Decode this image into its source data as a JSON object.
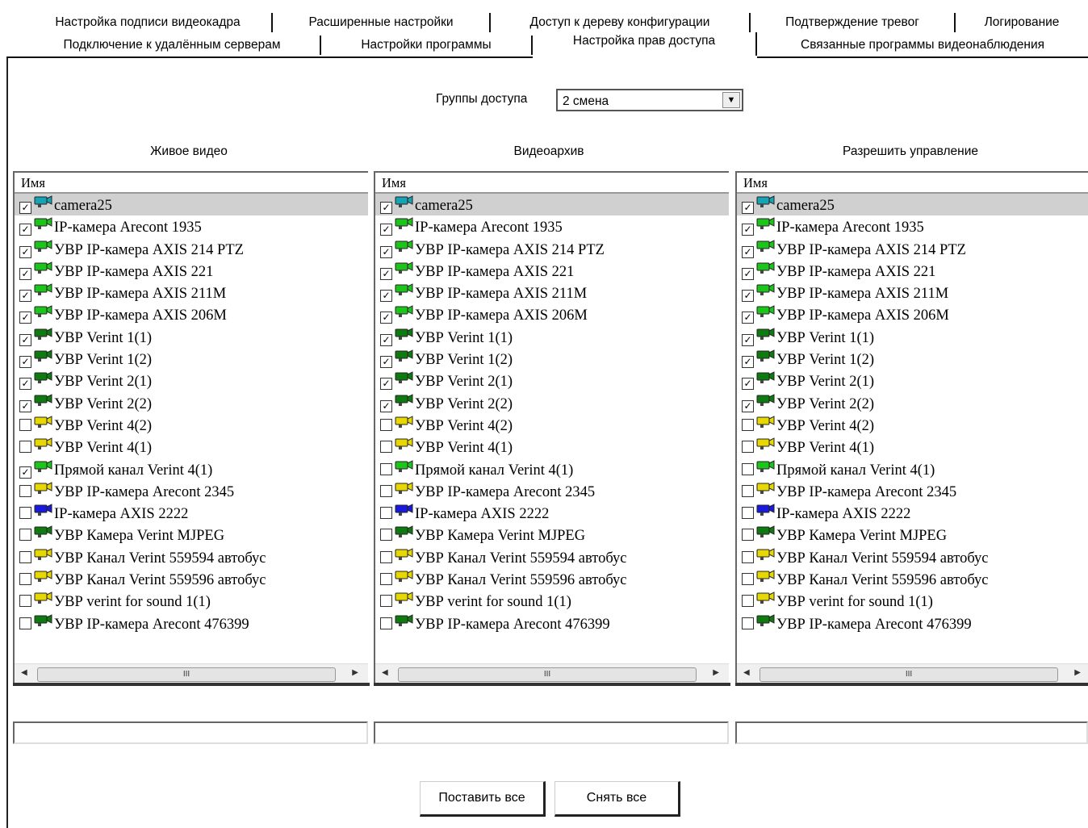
{
  "tabs_row1": [
    "Настройка подписи видеокадра",
    "Расширенные настройки",
    "Доступ к дереву конфигурации",
    "Подтверждение тревог",
    "Логирование"
  ],
  "tabs_row2": [
    "Подключение к удалённым серверам",
    "Настройки программы",
    "Настройка прав доступа",
    "Связанные программы видеонаблюдения"
  ],
  "active_tab": "Настройка прав доступа",
  "access_groups": {
    "label": "Группы доступа",
    "value": "2 смена"
  },
  "column_header": "Имя",
  "columns": [
    {
      "title": "Живое видео",
      "checked": [
        true,
        true,
        true,
        true,
        true,
        true,
        true,
        true,
        true,
        true,
        false,
        false,
        true,
        false,
        false,
        false,
        false,
        false,
        false,
        false
      ]
    },
    {
      "title": "Видеоархив",
      "checked": [
        true,
        true,
        true,
        true,
        true,
        true,
        true,
        true,
        true,
        true,
        false,
        false,
        false,
        false,
        false,
        false,
        false,
        false,
        false,
        false
      ]
    },
    {
      "title": "Разрешить управление",
      "checked": [
        true,
        true,
        true,
        true,
        true,
        true,
        true,
        true,
        true,
        true,
        false,
        false,
        false,
        false,
        false,
        false,
        false,
        false,
        false,
        false
      ]
    }
  ],
  "cameras": [
    {
      "name": "camera25",
      "icon_color": "#17a3b3"
    },
    {
      "name": "IP-камера Arecont 1935",
      "icon_color": "#1cc41c"
    },
    {
      "name": "УВР IP-камера AXIS 214 PTZ",
      "icon_color": "#1cc41c"
    },
    {
      "name": "УВР IP-камера AXIS 221",
      "icon_color": "#1cc41c"
    },
    {
      "name": "УВР IP-камера AXIS 211M",
      "icon_color": "#1cc41c"
    },
    {
      "name": "УВР IP-камера AXIS 206M",
      "icon_color": "#1cc41c"
    },
    {
      "name": "УВР Verint 1(1)",
      "icon_color": "#0f7a0f"
    },
    {
      "name": "УВР Verint 1(2)",
      "icon_color": "#0f7a0f"
    },
    {
      "name": "УВР Verint 2(1)",
      "icon_color": "#0f7a0f"
    },
    {
      "name": "УВР Verint 2(2)",
      "icon_color": "#0f7a0f"
    },
    {
      "name": "УВР Verint 4(2)",
      "icon_color": "#e6d800"
    },
    {
      "name": "УВР Verint 4(1)",
      "icon_color": "#e6d800"
    },
    {
      "name": "Прямой канал Verint 4(1)",
      "icon_color": "#1cc41c"
    },
    {
      "name": "УВР IP-камера Arecont 2345",
      "icon_color": "#e6d800"
    },
    {
      "name": "IP-камера AXIS 2222",
      "icon_color": "#1a1adc"
    },
    {
      "name": "УВР Камера Verint MJPEG",
      "icon_color": "#0f7a0f"
    },
    {
      "name": "УВР Канал Verint 559594 автобус",
      "icon_color": "#e6d800"
    },
    {
      "name": "УВР Канал Verint 559596 автобус",
      "icon_color": "#e6d800"
    },
    {
      "name": "УВР verint for sound 1(1)",
      "icon_color": "#e6d800"
    },
    {
      "name": "УВР IP-камера Arecont 476399",
      "icon_color": "#0f7a0f"
    }
  ],
  "scroll_thumb_grip": "III",
  "buttons": {
    "set_all": "Поставить все",
    "clear_all": "Снять все"
  }
}
